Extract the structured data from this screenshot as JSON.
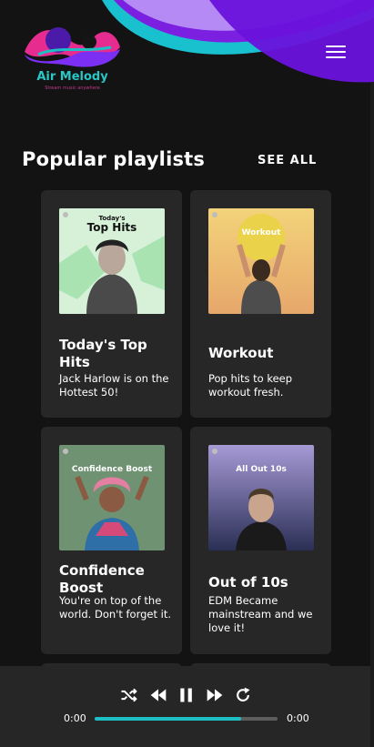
{
  "brand": {
    "name": "Air Melody",
    "tagline": "Stream music anywhere"
  },
  "section": {
    "title": "Popular playlists",
    "see_all": "SEE ALL"
  },
  "playlists": [
    {
      "title": "Today's Top Hits",
      "description": "Jack Harlow is on the Hottest 50!",
      "cover_text_line1": "Today's",
      "cover_text_line2": "Top Hits"
    },
    {
      "title": "Workout",
      "description": "Pop hits to keep workout fresh.",
      "cover_text": "Workout"
    },
    {
      "title": "Confidence Boost",
      "description": "You're on top of the world. Don't forget it.",
      "cover_text": "Confidence Boost"
    },
    {
      "title": "Out of 10s",
      "description": "EDM Became mainstream and we love it!",
      "cover_text": "All Out 10s"
    }
  ],
  "player": {
    "time_current": "0:00",
    "time_total": "0:00",
    "progress": 0.8
  },
  "colors": {
    "accent": "#1dbfc5",
    "card": "#272727",
    "background": "#131313"
  },
  "icons": [
    "menu-icon",
    "shuffle-icon",
    "previous-icon",
    "pause-icon",
    "next-icon",
    "repeat-icon"
  ]
}
